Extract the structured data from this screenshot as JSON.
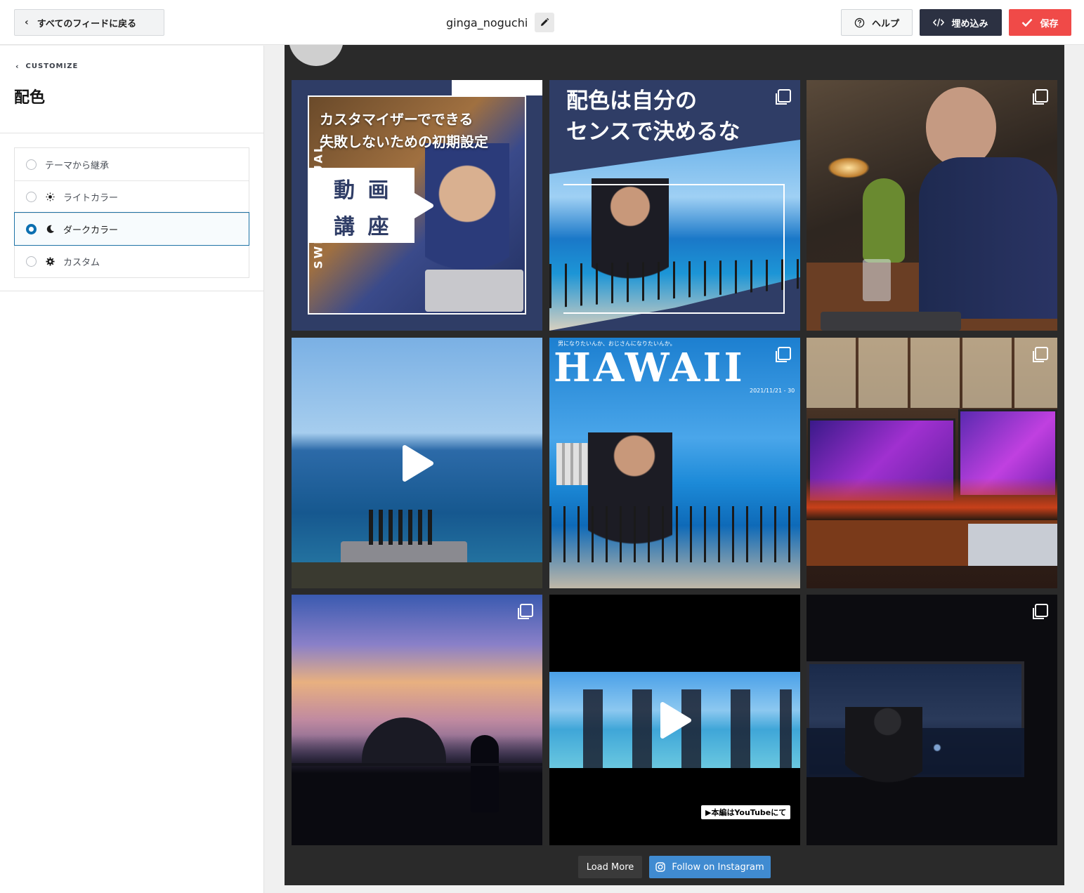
{
  "topbar": {
    "back_label": "すべてのフィードに戻る",
    "feed_name": "ginga_noguchi",
    "help_label": "ヘルプ",
    "embed_label": "埋め込み",
    "save_label": "保存"
  },
  "sidebar": {
    "breadcrumb": "CUSTOMIZE",
    "title": "配色",
    "options": [
      {
        "label": "テーマから継承",
        "icon": "none",
        "selected": false
      },
      {
        "label": "ライトカラー",
        "icon": "sun-icon",
        "selected": false
      },
      {
        "label": "ダークカラー",
        "icon": "moon-icon",
        "selected": true
      },
      {
        "label": "カスタム",
        "icon": "gear-icon",
        "selected": false
      }
    ]
  },
  "preview": {
    "posts": [
      {
        "type": "video",
        "text_lines": [
          "カスタマイザーでできる",
          "失敗しないための初期設定"
        ],
        "side_text": "SWELL MANUAL",
        "box_text": [
          "動 画",
          "講 座"
        ]
      },
      {
        "type": "carousel",
        "text_lines": [
          "配色は自分の",
          "センスで決めるな"
        ]
      },
      {
        "type": "carousel"
      },
      {
        "type": "video"
      },
      {
        "type": "carousel",
        "text_lines": [
          "HAWAII"
        ],
        "small_text": "男になりたいんか、おじさんになりたいんか。",
        "date": "2021/11/21 - 30"
      },
      {
        "type": "carousel"
      },
      {
        "type": "carousel"
      },
      {
        "type": "video",
        "caption": "▶本編はYouTubeにて"
      },
      {
        "type": "carousel"
      }
    ],
    "load_more_label": "Load More",
    "follow_label": "Follow on Instagram"
  },
  "colors": {
    "save": "#f04a48",
    "embed": "#2c3142",
    "follow": "#408bd1",
    "selected": "#0b6fb0"
  }
}
